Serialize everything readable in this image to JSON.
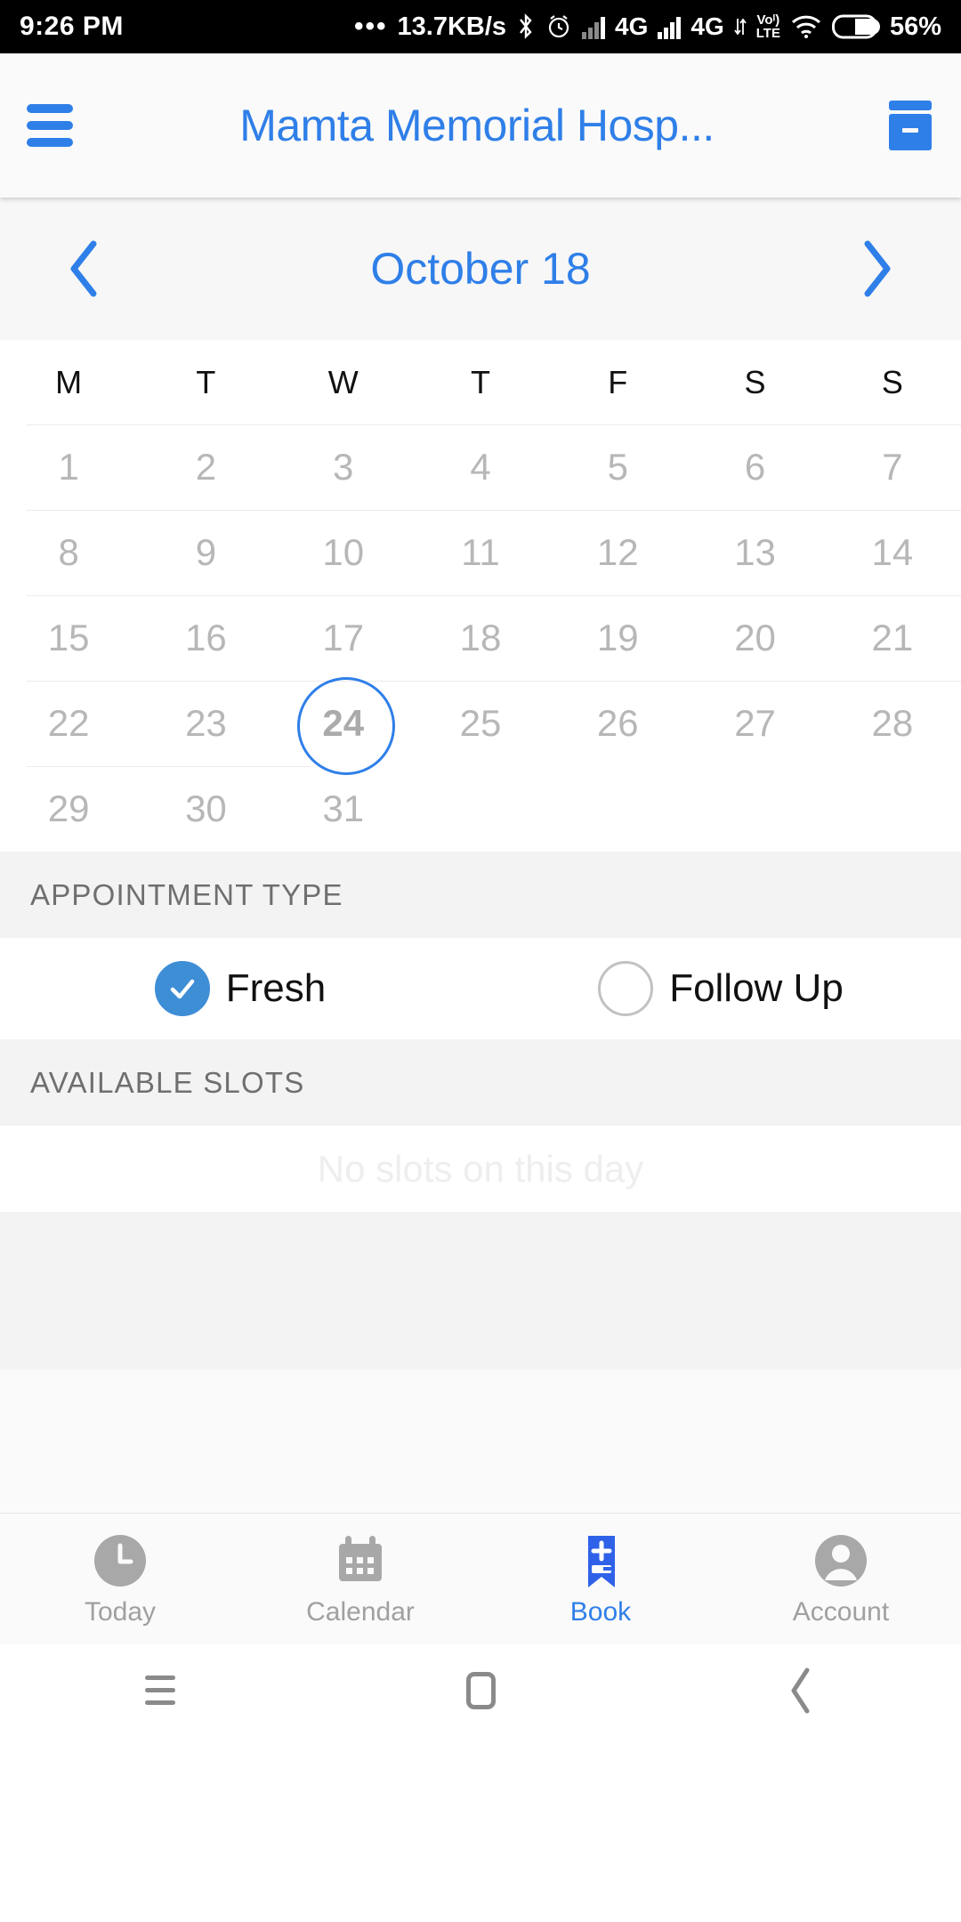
{
  "status_bar": {
    "time": "9:26 PM",
    "overflow_dots": "•••",
    "network_speed": "13.7KB/s",
    "bluetooth_icon": "bluetooth-icon",
    "alarm_icon": "alarm-icon",
    "sim1_network": "4G",
    "sim2_network": "4G",
    "volte_top": "Voᴵ)",
    "volte_bottom": "LTE",
    "wifi_icon": "wifi-icon",
    "battery_percent": "56%"
  },
  "app_bar": {
    "menu_icon": "hamburger-menu-icon",
    "title": "Mamta Memorial Hosp...",
    "action_icon": "id-card-icon"
  },
  "month_nav": {
    "prev_label": "‹",
    "month_label": "October 18",
    "next_label": "›"
  },
  "calendar": {
    "weekdays": [
      "M",
      "T",
      "W",
      "T",
      "F",
      "S",
      "S"
    ],
    "weeks": [
      [
        "1",
        "2",
        "3",
        "4",
        "5",
        "6",
        "7"
      ],
      [
        "8",
        "9",
        "10",
        "11",
        "12",
        "13",
        "14"
      ],
      [
        "15",
        "16",
        "17",
        "18",
        "19",
        "20",
        "21"
      ],
      [
        "22",
        "23",
        "24",
        "25",
        "26",
        "27",
        "28"
      ],
      [
        "29",
        "30",
        "31",
        "",
        "",
        "",
        ""
      ]
    ],
    "selected_day": "24",
    "selected_week_index": 3,
    "selected_col_index": 2,
    "selected_ring_color": "#2f7fe8"
  },
  "appointment_type": {
    "header": "APPOINTMENT TYPE",
    "options": [
      {
        "label": "Fresh",
        "selected": true
      },
      {
        "label": "Follow Up",
        "selected": false
      }
    ],
    "selected_color": "#3e8ed6"
  },
  "available_slots": {
    "header": "AVAILABLE SLOTS",
    "empty_message": "No slots on this day"
  },
  "bottom_nav": {
    "items": [
      {
        "label": "Today",
        "icon": "clock-icon",
        "active": false
      },
      {
        "label": "Calendar",
        "icon": "calendar-icon",
        "active": false
      },
      {
        "label": "Book",
        "icon": "book-plus-icon",
        "active": true
      },
      {
        "label": "Account",
        "icon": "person-icon",
        "active": false
      }
    ],
    "active_color": "#2f7fe8",
    "inactive_color": "#a0a0a0"
  },
  "android_nav": {
    "recents_icon": "recents-icon",
    "home_icon": "home-icon",
    "back_icon": "back-chevron-icon"
  }
}
